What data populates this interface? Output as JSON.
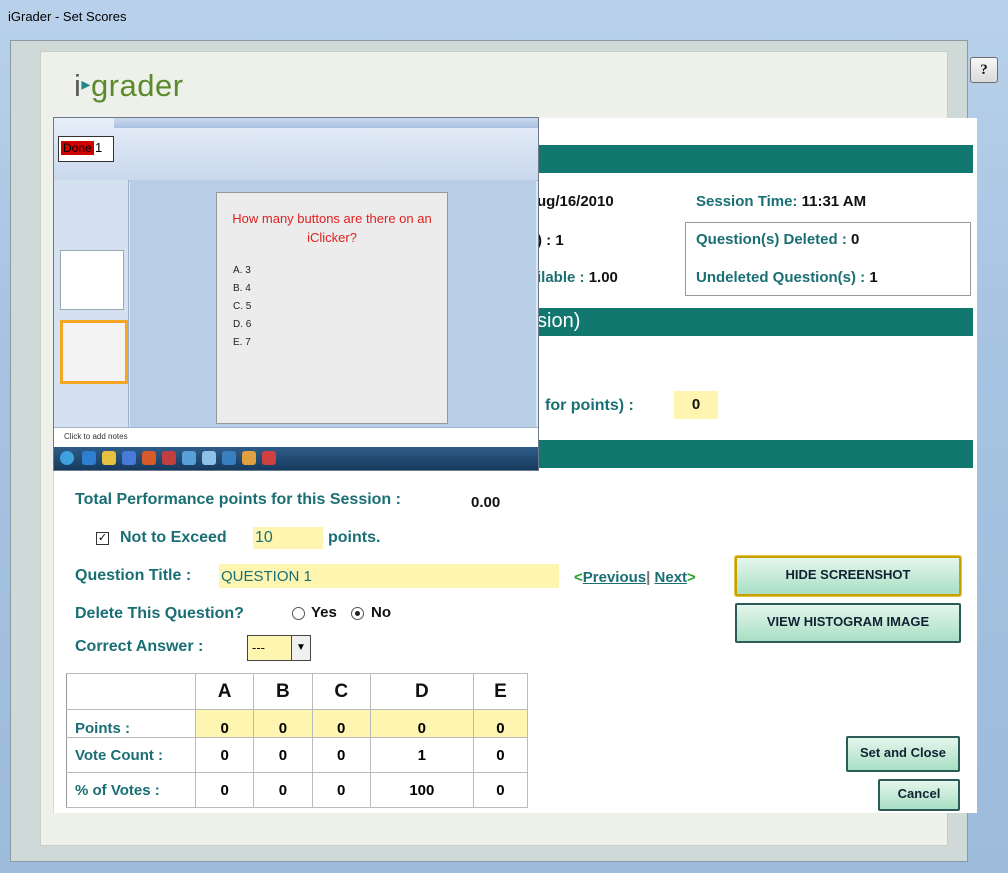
{
  "window": {
    "title": "iGrader - Set Scores",
    "help_label": "?"
  },
  "logo": {
    "i": "i",
    "arrow": "▸",
    "word": "grader"
  },
  "session": {
    "date_fragment": "ug/16/2010",
    "time_label": "Session Time:",
    "time_value": "11:31 AM",
    "count_fragment": ")  :",
    "count_value": "1",
    "points_fragment": "ilable :",
    "points_value": "1.00",
    "deleted_label": "Question(s) Deleted :",
    "deleted_value": "0",
    "undeleted_label": "Undeleted Question(s) :",
    "undeleted_value": "1"
  },
  "section2": {
    "header_fragment": "sion)",
    "participation_fragment": "for points) :",
    "participation_value": "0"
  },
  "screenshot": {
    "done_label": "Done",
    "done_count": "1",
    "slide_title": "How many buttons are there on an iClicker?",
    "options": [
      "A. 3",
      "B. 4",
      "C. 5",
      "D. 6",
      "E. 7"
    ],
    "notes_placeholder": "Click to add notes"
  },
  "performance": {
    "total_label": "Total Performance points for this Session :",
    "total_value": "0.00",
    "not_exceed_checked": true,
    "not_exceed_label": "Not to Exceed",
    "not_exceed_value": "10",
    "not_exceed_suffix": "points."
  },
  "question": {
    "title_label": "Question Title :",
    "title_value": "QUESTION 1",
    "prev_label": "Previous",
    "next_label": "Next",
    "delete_label": "Delete This Question?",
    "delete_yes": "Yes",
    "delete_no": "No",
    "delete_selected": "No",
    "correct_label": "Correct Answer :",
    "correct_value": "---"
  },
  "buttons": {
    "hide_screenshot": "HIDE SCREENSHOT",
    "view_histogram": "VIEW HISTOGRAM  IMAGE",
    "set_close": "Set and Close",
    "cancel": "Cancel"
  },
  "scores": {
    "columns": [
      "A",
      "B",
      "C",
      "D",
      "E"
    ],
    "rows": [
      {
        "label": "Points :",
        "values": [
          "0",
          "0",
          "0",
          "0",
          "0"
        ]
      },
      {
        "label": "Vote Count :",
        "values": [
          "0",
          "0",
          "0",
          "1",
          "0"
        ]
      },
      {
        "label": "% of Votes  :",
        "values": [
          "0",
          "0",
          "0",
          "100",
          "0"
        ]
      }
    ]
  },
  "colors": {
    "accent": "#12776f",
    "label": "#1a6f74",
    "highlight": "#fdf5b0"
  }
}
